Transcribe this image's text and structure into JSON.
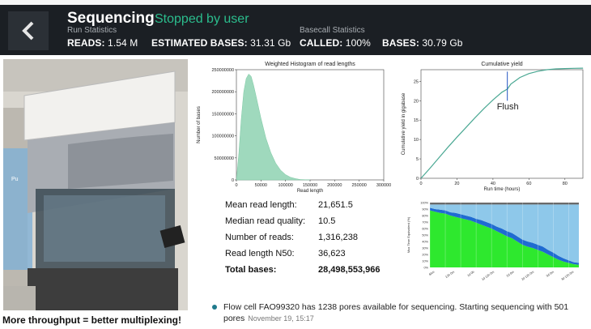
{
  "run": {
    "title": "Sequencing",
    "state": "Stopped by user",
    "run_stats_heading": "Run Statistics",
    "basecall_heading": "Basecall Statistics",
    "reads_label": "READS:",
    "reads_value": "1.54 M",
    "est_bases_label": "ESTIMATED BASES:",
    "est_bases_value": "31.31 Gb",
    "called_label": "CALLED:",
    "called_value": "100%",
    "bases_label": "BASES:",
    "bases_value": "30.79 Gb"
  },
  "photo": {
    "label": "Pu"
  },
  "caption": "More throughput = better multiplexing!",
  "summary": {
    "rows": [
      {
        "label": "Mean read length:",
        "value": "21,651.5"
      },
      {
        "label": "Median read quality:",
        "value": "10.5"
      },
      {
        "label": "Number of reads:",
        "value": "1,316,238"
      },
      {
        "label": "Read length N50:",
        "value": "36,623"
      },
      {
        "label": "Total bases:",
        "value": "28,498,553,966"
      }
    ]
  },
  "notice": {
    "text": "Flow cell FAO99320 has 1238 pores available for sequencing. Starting sequencing with 501 pores",
    "time": "November 19, 15:17"
  },
  "colors": {
    "banner": "#1b1f24",
    "accent": "#2bbd8d",
    "hist": "#9fd9bd",
    "yield": "#4aa893"
  },
  "chart_data": [
    {
      "type": "area",
      "title": "Weighted Histogram of read lengths",
      "xlabel": "Read length",
      "ylabel": "Number of bases",
      "xlim": [
        0,
        300000
      ],
      "ylim": [
        0,
        250000000
      ],
      "xticks": [
        "0",
        "50000",
        "100000",
        "150000",
        "200000",
        "250000",
        "300000"
      ],
      "yticks": [
        "0",
        "50000000",
        "100000000",
        "150000000",
        "200000000",
        "250000000"
      ],
      "x": [
        0,
        5000,
        10000,
        15000,
        20000,
        25000,
        30000,
        35000,
        40000,
        50000,
        60000,
        70000,
        80000,
        90000,
        100000,
        110000,
        120000,
        130000,
        150000
      ],
      "y": [
        0,
        60000000,
        140000000,
        200000000,
        230000000,
        240000000,
        235000000,
        215000000,
        190000000,
        140000000,
        95000000,
        62000000,
        38000000,
        22000000,
        12000000,
        6000000,
        3000000,
        1000000,
        0
      ]
    },
    {
      "type": "line",
      "title": "Cumulative yield",
      "xlabel": "Run time (hours)",
      "ylabel": "Cumulative yield in gigabase",
      "xlim": [
        0,
        90
      ],
      "ylim": [
        0,
        28
      ],
      "xticks": [
        "0",
        "20",
        "40",
        "60",
        "80"
      ],
      "yticks": [
        "0",
        "5",
        "10",
        "15",
        "20",
        "25"
      ],
      "annotation": "Flush",
      "annotation_x": 48,
      "x": [
        0,
        5,
        10,
        15,
        20,
        25,
        30,
        35,
        40,
        45,
        48,
        50,
        55,
        60,
        65,
        70,
        75,
        80,
        85,
        90
      ],
      "y": [
        0,
        2.6,
        5.3,
        8.0,
        10.6,
        13.1,
        15.6,
        18.0,
        20.2,
        22.2,
        23.0,
        24.3,
        26.0,
        27.0,
        27.6,
        28.0,
        28.2,
        28.3,
        28.35,
        28.4
      ]
    },
    {
      "type": "area",
      "title": "",
      "ylabel": "Mux Time Equivalent (%)",
      "ylim": [
        0,
        100
      ],
      "yticks": [
        "0%",
        "10%",
        "20%",
        "30%",
        "40%",
        "50%",
        "60%",
        "70%",
        "80%",
        "90%",
        "100%"
      ],
      "xticks": [
        "6hm",
        "12h 0m",
        "1d 0h",
        "1d 12h 0m",
        "2d 0m",
        "2d 12h 0m",
        "3d 0m",
        "3d 12h 0m"
      ],
      "series": [
        {
          "name": "",
          "color": "#2ee82e",
          "values": [
            88,
            86,
            84,
            83,
            80,
            78,
            76,
            74,
            72,
            69,
            66,
            63,
            60,
            56,
            52,
            48,
            45,
            40,
            35,
            32,
            30,
            27,
            24,
            20,
            16,
            12,
            9,
            7,
            5,
            4
          ]
        },
        {
          "name": "",
          "color": "#1f6bd1",
          "values": [
            4,
            4,
            5,
            5,
            5,
            6,
            6,
            6,
            6,
            6,
            7,
            7,
            7,
            7,
            8,
            8,
            8,
            8,
            8,
            8,
            8,
            8,
            8,
            7,
            7,
            6,
            5,
            4,
            3,
            3
          ]
        },
        {
          "name": "",
          "color": "#8ec8ea",
          "values": [
            5,
            7,
            8,
            9,
            12,
            13,
            15,
            17,
            19,
            22,
            24,
            27,
            30,
            34,
            37,
            41,
            44,
            49,
            54,
            57,
            59,
            62,
            65,
            70,
            74,
            79,
            83,
            86,
            89,
            90
          ]
        },
        {
          "name": "",
          "color": "#6a6a6a",
          "values": [
            3,
            3,
            3,
            3,
            3,
            3,
            3,
            3,
            3,
            3,
            3,
            3,
            3,
            3,
            3,
            3,
            3,
            3,
            3,
            3,
            3,
            3,
            3,
            3,
            3,
            3,
            3,
            3,
            3,
            3
          ]
        }
      ]
    }
  ]
}
